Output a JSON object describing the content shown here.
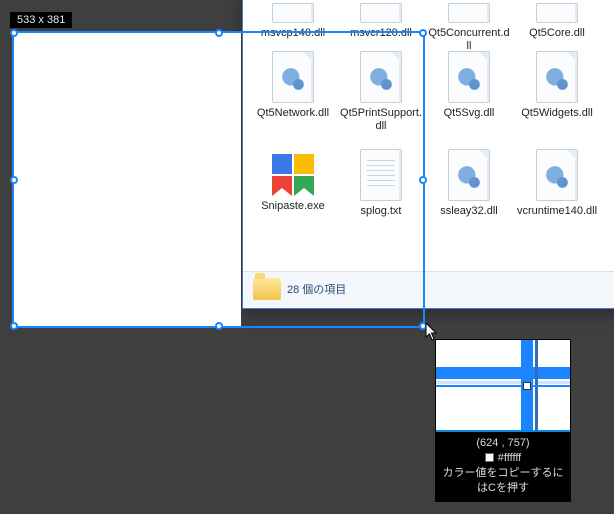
{
  "selection": {
    "size_label": "533 x 381",
    "coords_label": "(624 , 757)",
    "color_hex": "#ffffff",
    "hint": "カラー値をコピーするにはCを押す"
  },
  "explorer": {
    "status": "28 個の項目",
    "rows": [
      [
        "msvcp140.dll",
        "msvcr120.dll",
        "Qt5Concurrent.dll",
        "Qt5Core.dll"
      ],
      [
        "Qt5Network.dll",
        "Qt5PrintSupport.dll",
        "Qt5Svg.dll",
        "Qt5Widgets.dll"
      ],
      [
        "Snipaste.exe",
        "splog.txt",
        "ssleay32.dll",
        "vcruntime140.dll"
      ]
    ]
  }
}
